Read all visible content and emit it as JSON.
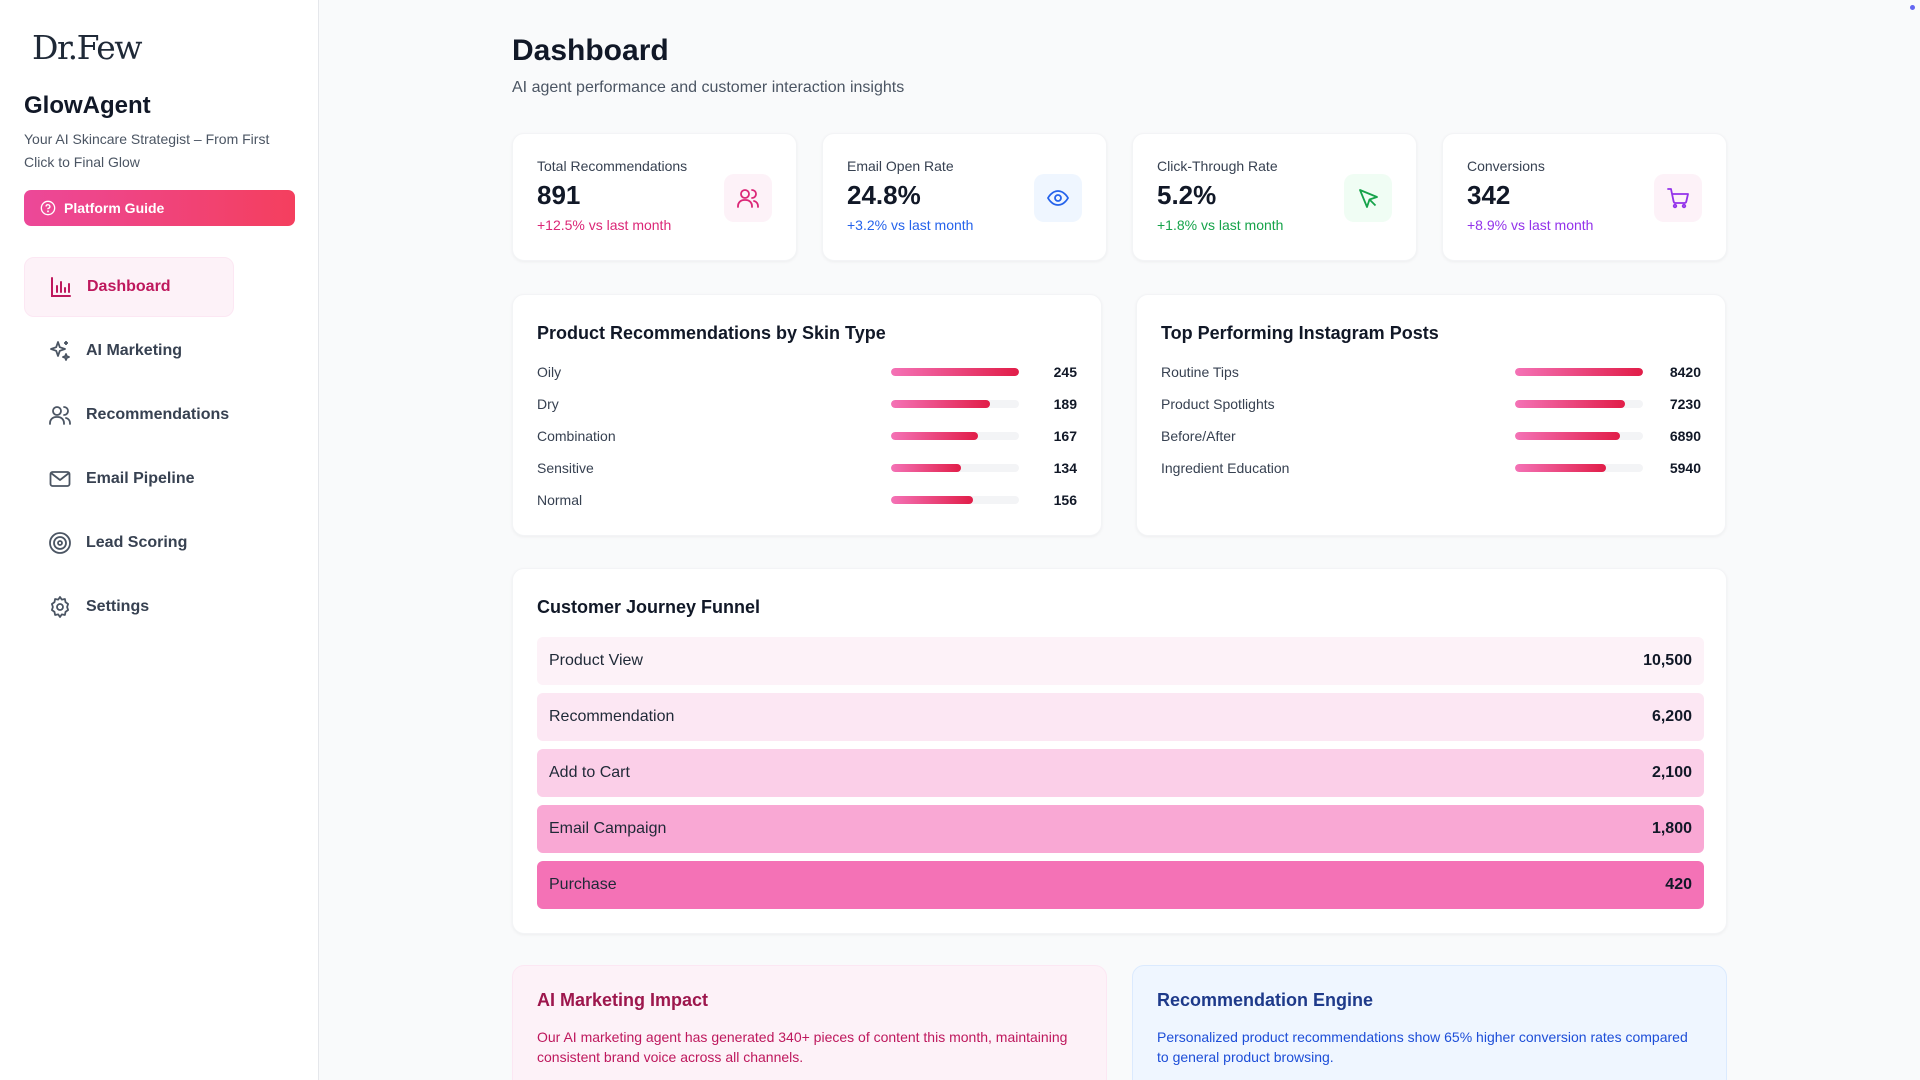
{
  "sidebar": {
    "logo": "Dr.Few",
    "app_title": "GlowAgent",
    "app_subtitle": "Your AI Skincare Strategist – From First Click to Final Glow",
    "guide_label": "Platform Guide",
    "items": [
      {
        "label": "Dashboard",
        "icon": "bar-chart-icon",
        "active": true
      },
      {
        "label": "AI Marketing",
        "icon": "sparkles-icon"
      },
      {
        "label": "Recommendations",
        "icon": "users-icon"
      },
      {
        "label": "Email Pipeline",
        "icon": "mail-icon"
      },
      {
        "label": "Lead Scoring",
        "icon": "target-icon"
      },
      {
        "label": "Settings",
        "icon": "gear-icon"
      }
    ]
  },
  "header": {
    "title": "Dashboard",
    "subtitle": "AI agent performance and customer interaction insights"
  },
  "stats": [
    {
      "label": "Total Recommendations",
      "value": "891",
      "delta": "+12.5% vs last month",
      "color": "#db2777",
      "icon": "users-icon",
      "icon_bg": "#fdf2f8"
    },
    {
      "label": "Email Open Rate",
      "value": "24.8%",
      "delta": "+3.2% vs last month",
      "color": "#2563eb",
      "icon": "eye-icon",
      "icon_bg": "#eff6ff"
    },
    {
      "label": "Click-Through Rate",
      "value": "5.2%",
      "delta": "+1.8% vs last month",
      "color": "#16a34a",
      "icon": "cursor-icon",
      "icon_bg": "#f0fdf4"
    },
    {
      "label": "Conversions",
      "value": "342",
      "delta": "+8.9% vs last month",
      "color": "#9333ea",
      "icon": "cart-icon",
      "icon_bg": "#fdf2f8"
    }
  ],
  "skin_types": {
    "title": "Product Recommendations by Skin Type",
    "rows": [
      {
        "label": "Oily",
        "value": "245",
        "fraction": 1.0
      },
      {
        "label": "Dry",
        "value": "189",
        "fraction": 0.77
      },
      {
        "label": "Combination",
        "value": "167",
        "fraction": 0.68
      },
      {
        "label": "Sensitive",
        "value": "134",
        "fraction": 0.55
      },
      {
        "label": "Normal",
        "value": "156",
        "fraction": 0.64
      }
    ]
  },
  "instagram": {
    "title": "Top Performing Instagram Posts",
    "rows": [
      {
        "label": "Routine Tips",
        "value": "8420",
        "fraction": 1.0
      },
      {
        "label": "Product Spotlights",
        "value": "7230",
        "fraction": 0.86
      },
      {
        "label": "Before/After",
        "value": "6890",
        "fraction": 0.82
      },
      {
        "label": "Ingredient Education",
        "value": "5940",
        "fraction": 0.71
      }
    ]
  },
  "funnel": {
    "title": "Customer Journey Funnel",
    "rows": [
      {
        "label": "Product View",
        "value": "10,500",
        "color": "#fdf2f8"
      },
      {
        "label": "Recommendation",
        "value": "6,200",
        "color": "#fce7f3"
      },
      {
        "label": "Add to Cart",
        "value": "2,100",
        "color": "#fbcfe8"
      },
      {
        "label": "Email Campaign",
        "value": "1,800",
        "color": "#f9a8d4"
      },
      {
        "label": "Purchase",
        "value": "420",
        "color": "#f472b6"
      }
    ]
  },
  "insights": [
    {
      "title": "AI Marketing Impact",
      "text": "Our AI marketing agent has generated 340+ pieces of content this month, maintaining consistent brand voice across all channels.",
      "bg": "#fdf2f8",
      "title_color": "#9d174d",
      "text_color": "#be185d"
    },
    {
      "title": "Recommendation Engine",
      "text": "Personalized product recommendations show 65% higher conversion rates compared to general product browsing.",
      "bg": "#eff6ff",
      "title_color": "#1e3a8a",
      "text_color": "#1d4ed8"
    }
  ]
}
